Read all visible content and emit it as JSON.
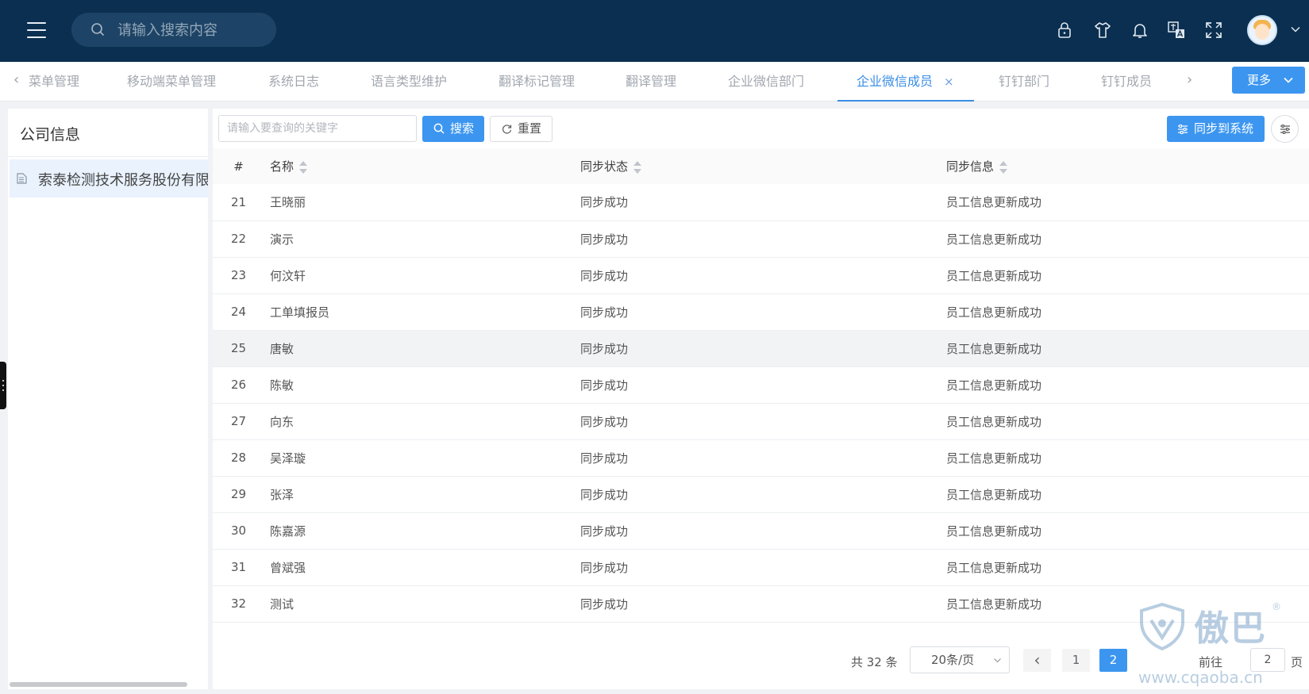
{
  "header": {
    "search_placeholder": "请输入搜索内容",
    "icons": [
      "menu-icon",
      "search-icon",
      "lock-icon",
      "theme-icon",
      "bell-icon",
      "translate-icon",
      "fullscreen-icon",
      "avatar",
      "chevron-down-icon"
    ]
  },
  "tabs": {
    "items": [
      {
        "label": "菜单管理"
      },
      {
        "label": "移动端菜单管理"
      },
      {
        "label": "系统日志"
      },
      {
        "label": "语言类型维护"
      },
      {
        "label": "翻译标记管理"
      },
      {
        "label": "翻译管理"
      },
      {
        "label": "企业微信部门"
      },
      {
        "label": "企业微信成员",
        "active": true
      },
      {
        "label": "钉钉部门"
      },
      {
        "label": "钉钉成员"
      }
    ],
    "close_glyph": "×",
    "more_label": "更多"
  },
  "left": {
    "title": "公司信息",
    "company": "索泰检测技术服务股份有限公司"
  },
  "toolbar": {
    "keyword_placeholder": "请输入要查询的关键字",
    "search_label": "搜索",
    "reset_label": "重置",
    "sync_label": "同步到系统"
  },
  "table": {
    "headers": {
      "index": "#",
      "name": "名称",
      "status": "同步状态",
      "info": "同步信息"
    },
    "rows": [
      {
        "index": "21",
        "name": "王晓丽",
        "status": "同步成功",
        "info": "员工信息更新成功"
      },
      {
        "index": "22",
        "name": "演示",
        "status": "同步成功",
        "info": "员工信息更新成功"
      },
      {
        "index": "23",
        "name": "何汶轩",
        "status": "同步成功",
        "info": "员工信息更新成功"
      },
      {
        "index": "24",
        "name": "工单填报员",
        "status": "同步成功",
        "info": "员工信息更新成功"
      },
      {
        "index": "25",
        "name": "唐敏",
        "status": "同步成功",
        "info": "员工信息更新成功"
      },
      {
        "index": "26",
        "name": "陈敏",
        "status": "同步成功",
        "info": "员工信息更新成功"
      },
      {
        "index": "27",
        "name": "向东",
        "status": "同步成功",
        "info": "员工信息更新成功"
      },
      {
        "index": "28",
        "name": "吴泽璇",
        "status": "同步成功",
        "info": "员工信息更新成功"
      },
      {
        "index": "29",
        "name": "张泽",
        "status": "同步成功",
        "info": "员工信息更新成功"
      },
      {
        "index": "30",
        "name": "陈嘉源",
        "status": "同步成功",
        "info": "员工信息更新成功"
      },
      {
        "index": "31",
        "name": "曾斌强",
        "status": "同步成功",
        "info": "员工信息更新成功"
      },
      {
        "index": "32",
        "name": "测试",
        "status": "同步成功",
        "info": "员工信息更新成功"
      }
    ],
    "hovered_index": "25"
  },
  "pagination": {
    "total": "共 32 条",
    "page_size": "20条/页",
    "prev_glyph": "‹",
    "pages": [
      "1",
      "2"
    ],
    "current": "2",
    "goto_label": "前往",
    "goto_value": "2",
    "goto_suffix": "页"
  },
  "watermark": {
    "brand": "傲巴",
    "url": "www.cqaoba.cn",
    "reg": "®"
  },
  "colors": {
    "header_bg": "#0b2f50",
    "accent": "#3c96f0",
    "active_tab": "#3a8ee6"
  }
}
